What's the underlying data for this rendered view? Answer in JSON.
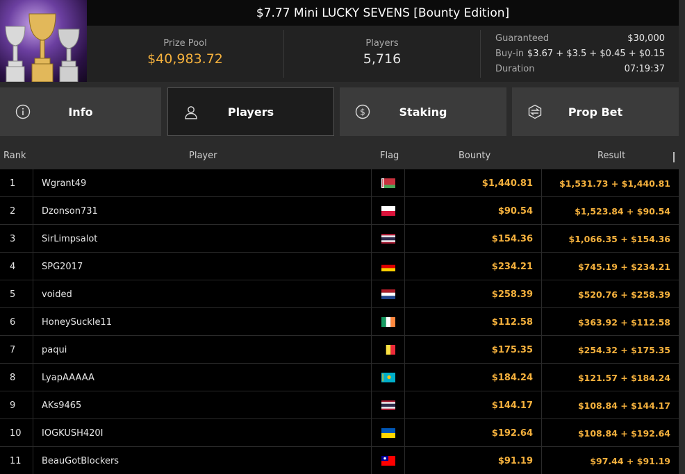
{
  "tournament": {
    "title": "$7.77 Mini LUCKY SEVENS [Bounty Edition]",
    "prize_pool_label": "Prize Pool",
    "prize_pool_value": "$40,983.72",
    "players_label": "Players",
    "players_value": "5,716",
    "guaranteed_label": "Guaranteed",
    "guaranteed_value": "$30,000",
    "buyin_label": "Buy-in",
    "buyin_value": "$3.67 + $3.5 + $0.45 + $0.15",
    "duration_label": "Duration",
    "duration_value": "07:19:37"
  },
  "tabs": [
    {
      "label": "Info",
      "icon": "info-icon",
      "active": false
    },
    {
      "label": "Players",
      "icon": "user-icon",
      "active": true
    },
    {
      "label": "Staking",
      "icon": "dollar-coin-icon",
      "active": false
    },
    {
      "label": "Prop Bet",
      "icon": "prop-bet-icon",
      "active": false
    }
  ],
  "table": {
    "headers": {
      "rank": "Rank",
      "player": "Player",
      "flag": "Flag",
      "bounty": "Bounty",
      "result": "Result"
    },
    "rows": [
      {
        "rank": "1",
        "player": "Wgrant49",
        "flag": "belarus",
        "bounty": "$1,440.81",
        "result": "$1,531.73 + $1,440.81"
      },
      {
        "rank": "2",
        "player": "Dzonson731",
        "flag": "poland",
        "bounty": "$90.54",
        "result": "$1,523.84 + $90.54"
      },
      {
        "rank": "3",
        "player": "SirLimpsalot",
        "flag": "thailand",
        "bounty": "$154.36",
        "result": "$1,066.35 + $154.36"
      },
      {
        "rank": "4",
        "player": "SPG2017",
        "flag": "germany",
        "bounty": "$234.21",
        "result": "$745.19 + $234.21"
      },
      {
        "rank": "5",
        "player": "voided",
        "flag": "netherlands",
        "bounty": "$258.39",
        "result": "$520.76 + $258.39"
      },
      {
        "rank": "6",
        "player": "HoneySuckle11",
        "flag": "ireland",
        "bounty": "$112.58",
        "result": "$363.92 + $112.58"
      },
      {
        "rank": "7",
        "player": "paqui",
        "flag": "belgium",
        "bounty": "$175.35",
        "result": "$254.32 + $175.35"
      },
      {
        "rank": "8",
        "player": "LyapAAAAA",
        "flag": "kazakhstan",
        "bounty": "$184.24",
        "result": "$121.57 + $184.24"
      },
      {
        "rank": "9",
        "player": "AKs9465",
        "flag": "thailand",
        "bounty": "$144.17",
        "result": "$108.84 + $144.17"
      },
      {
        "rank": "10",
        "player": "IOGKUSH420I",
        "flag": "ukraine",
        "bounty": "$192.64",
        "result": "$108.84 + $192.64"
      },
      {
        "rank": "11",
        "player": "BeauGotBlockers",
        "flag": "taiwan",
        "bounty": "$91.19",
        "result": "$97.44 + $91.19"
      }
    ]
  },
  "colors": {
    "accent": "#f5b13d",
    "background": "#000000",
    "panel": "#222222"
  }
}
